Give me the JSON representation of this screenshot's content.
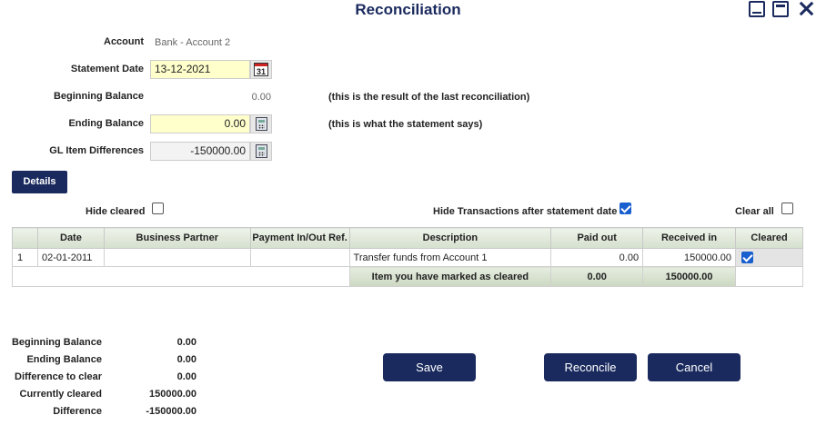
{
  "window": {
    "title": "Reconciliation"
  },
  "form": {
    "account_label": "Account",
    "account_value": "Bank - Account 2",
    "statement_date_label": "Statement Date",
    "statement_date_value": "13-12-2021",
    "calendar_glyph": "31",
    "beginning_balance_label": "Beginning Balance",
    "beginning_balance_value": "0.00",
    "beginning_balance_note": "(this is the result of the last reconciliation)",
    "ending_balance_label": "Ending Balance",
    "ending_balance_value": "0.00",
    "ending_balance_note": "(this is what the statement says)",
    "gl_diff_label": "GL Item Differences",
    "gl_diff_value": "-150000.00"
  },
  "details_button": "Details",
  "filters": {
    "hide_cleared_label": "Hide cleared",
    "hide_cleared_checked": false,
    "hide_after_date_label": "Hide Transactions after statement date",
    "hide_after_date_checked": true,
    "clear_all_label": "Clear all",
    "clear_all_checked": false
  },
  "table": {
    "headers": [
      "",
      "Date",
      "Business Partner",
      "Payment In/Out Ref.",
      "Description",
      "Paid out",
      "Received in",
      "Cleared"
    ],
    "rows": [
      {
        "no": "1",
        "date": "02-01-2011",
        "partner": "",
        "ref": "",
        "description": "Transfer funds from Account 1",
        "paid_out": "0.00",
        "received_in": "150000.00",
        "cleared": true
      }
    ],
    "totals": {
      "label": "Item you have marked as cleared",
      "paid_out": "0.00",
      "received_in": "150000.00"
    }
  },
  "summary": {
    "beginning_balance_label": "Beginning Balance",
    "beginning_balance_value": "0.00",
    "ending_balance_label": "Ending Balance",
    "ending_balance_value": "0.00",
    "difference_to_clear_label": "Difference to clear",
    "difference_to_clear_value": "0.00",
    "currently_cleared_label": "Currently cleared",
    "currently_cleared_value": "150000.00",
    "difference_label": "Difference",
    "difference_value": "-150000.00"
  },
  "buttons": {
    "save": "Save",
    "reconcile": "Reconcile",
    "cancel": "Cancel"
  },
  "colors": {
    "primary": "#1a2a5e",
    "input_highlight": "#ffffcc",
    "header_green": "#d5e0cd"
  }
}
